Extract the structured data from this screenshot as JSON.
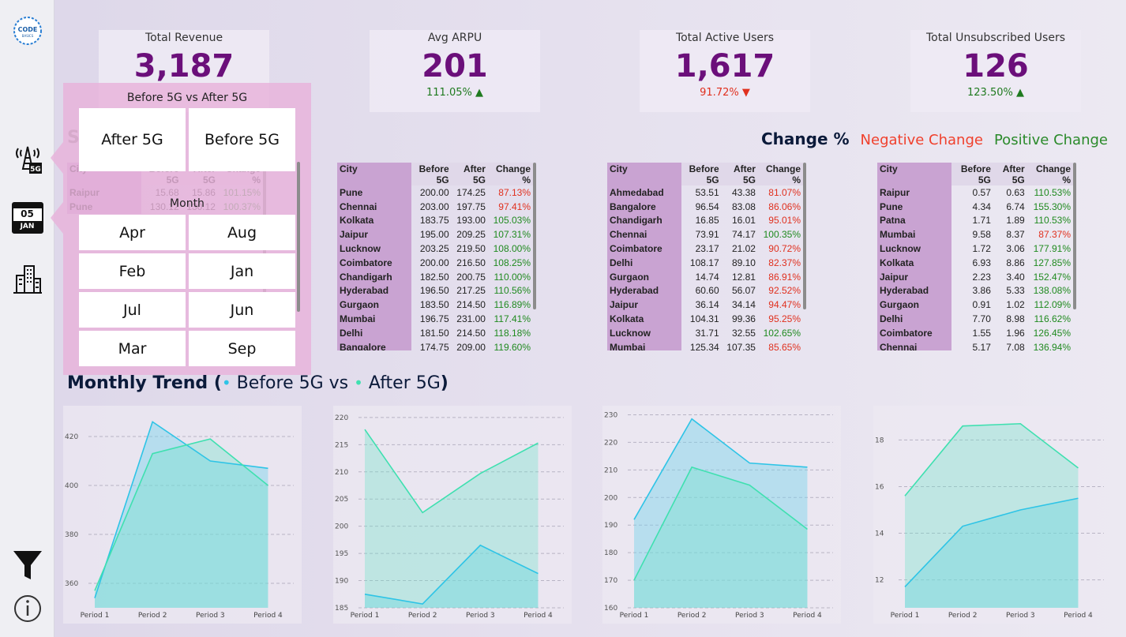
{
  "sidebar": {
    "logo_text": "CODE BASICS",
    "icons": [
      "tower-5g-icon",
      "calendar-icon",
      "city-icon",
      "filter-icon",
      "info-icon"
    ],
    "calendar_day": "05",
    "calendar_month": "JAN",
    "tower_label": "5G"
  },
  "kpis": [
    {
      "title": "Total Revenue",
      "value": "3,187",
      "change": "",
      "direction": "up"
    },
    {
      "title": "Avg ARPU",
      "value": "201",
      "change": "111.05%",
      "direction": "up"
    },
    {
      "title": "Total Active Users",
      "value": "1,617",
      "change": "91.72%",
      "direction": "down"
    },
    {
      "title": "Total Unsubscribed Users",
      "value": "126",
      "change": "123.50%",
      "direction": "up"
    }
  ],
  "legend": {
    "label": "Change %",
    "negative": "Negative Change",
    "positive": "Positive Change"
  },
  "section_letter": "S",
  "tables": [
    {
      "headers": [
        "City",
        "Before 5G",
        "After 5G",
        "Change %"
      ],
      "rows": [
        [
          "Raipur",
          "15.68",
          "15.86",
          "101.15%"
        ],
        [
          "Pune",
          "130.12",
          "130.12",
          "100.37%"
        ]
      ]
    },
    {
      "headers": [
        "City",
        "Before 5G",
        "After 5G",
        "Change %"
      ],
      "rows": [
        [
          "Pune",
          "200.00",
          "174.25",
          "87.13%"
        ],
        [
          "Chennai",
          "203.00",
          "197.75",
          "97.41%"
        ],
        [
          "Kolkata",
          "183.75",
          "193.00",
          "105.03%"
        ],
        [
          "Jaipur",
          "195.00",
          "209.25",
          "107.31%"
        ],
        [
          "Lucknow",
          "203.25",
          "219.50",
          "108.00%"
        ],
        [
          "Coimbatore",
          "200.00",
          "216.50",
          "108.25%"
        ],
        [
          "Chandigarh",
          "182.50",
          "200.75",
          "110.00%"
        ],
        [
          "Hyderabad",
          "196.50",
          "217.25",
          "110.56%"
        ],
        [
          "Gurgaon",
          "183.50",
          "214.50",
          "116.89%"
        ],
        [
          "Mumbai",
          "196.75",
          "231.00",
          "117.41%"
        ],
        [
          "Delhi",
          "181.50",
          "214.50",
          "118.18%"
        ],
        [
          "Bangalore",
          "174.75",
          "209.00",
          "119.60%"
        ]
      ]
    },
    {
      "headers": [
        "City",
        "Before 5G",
        "After 5G",
        "Change %"
      ],
      "rows": [
        [
          "Ahmedabad",
          "53.51",
          "43.38",
          "81.07%"
        ],
        [
          "Bangalore",
          "96.54",
          "83.08",
          "86.06%"
        ],
        [
          "Chandigarh",
          "16.85",
          "16.01",
          "95.01%"
        ],
        [
          "Chennai",
          "73.91",
          "74.17",
          "100.35%"
        ],
        [
          "Coimbatore",
          "23.17",
          "21.02",
          "90.72%"
        ],
        [
          "Delhi",
          "108.17",
          "89.10",
          "82.37%"
        ],
        [
          "Gurgaon",
          "14.74",
          "12.81",
          "86.91%"
        ],
        [
          "Hyderabad",
          "60.60",
          "56.07",
          "92.52%"
        ],
        [
          "Jaipur",
          "36.14",
          "34.14",
          "94.47%"
        ],
        [
          "Kolkata",
          "104.31",
          "99.36",
          "95.25%"
        ],
        [
          "Lucknow",
          "31.71",
          "32.55",
          "102.65%"
        ],
        [
          "Mumbai",
          "125.34",
          "107.35",
          "85.65%"
        ]
      ]
    },
    {
      "headers": [
        "City",
        "Before 5G",
        "After 5G",
        "Change %"
      ],
      "rows": [
        [
          "Raipur",
          "0.57",
          "0.63",
          "110.53%"
        ],
        [
          "Pune",
          "4.34",
          "6.74",
          "155.30%"
        ],
        [
          "Patna",
          "1.71",
          "1.89",
          "110.53%"
        ],
        [
          "Mumbai",
          "9.58",
          "8.37",
          "87.37%"
        ],
        [
          "Lucknow",
          "1.72",
          "3.06",
          "177.91%"
        ],
        [
          "Kolkata",
          "6.93",
          "8.86",
          "127.85%"
        ],
        [
          "Jaipur",
          "2.23",
          "3.40",
          "152.47%"
        ],
        [
          "Hyderabad",
          "3.86",
          "5.33",
          "138.08%"
        ],
        [
          "Gurgaon",
          "0.91",
          "1.02",
          "112.09%"
        ],
        [
          "Delhi",
          "7.70",
          "8.98",
          "116.62%"
        ],
        [
          "Coimbatore",
          "1.55",
          "1.96",
          "126.45%"
        ],
        [
          "Chennai",
          "5.17",
          "7.08",
          "136.94%"
        ]
      ]
    }
  ],
  "trend": {
    "title": "Monthly Trend (",
    "before": "Before 5G",
    "vs": "vs",
    "after": "After 5G",
    "close": ")"
  },
  "colors": {
    "before": "#2ec4e6",
    "after": "#3fe0b0",
    "accent": "#6b0f7a",
    "positive": "#1f8a1f",
    "negative": "#e0301e"
  },
  "chart_data": [
    {
      "type": "area",
      "x": [
        "Period 1",
        "Period 2",
        "Period 3",
        "Period 4"
      ],
      "ylim": [
        350,
        430
      ],
      "yticks": [
        360,
        380,
        400,
        420
      ],
      "series": [
        {
          "name": "Before 5G",
          "values": [
            354,
            426,
            410,
            407
          ]
        },
        {
          "name": "After 5G",
          "values": [
            357,
            413,
            419,
            400
          ]
        }
      ]
    },
    {
      "type": "area",
      "x": [
        "Period 1",
        "Period 2",
        "Period 3",
        "Period 4"
      ],
      "ylim": [
        185,
        221
      ],
      "yticks": [
        185,
        190,
        195,
        200,
        205,
        210,
        215,
        220
      ],
      "series": [
        {
          "name": "Before 5G",
          "values": [
            187.5,
            185.7,
            196.5,
            191.3
          ]
        },
        {
          "name": "After 5G",
          "values": [
            217.8,
            202.5,
            209.7,
            215.3
          ]
        }
      ]
    },
    {
      "type": "area",
      "x": [
        "Period 1",
        "Period 2",
        "Period 3",
        "Period 4"
      ],
      "ylim": [
        160,
        231
      ],
      "yticks": [
        160,
        170,
        180,
        190,
        200,
        210,
        220,
        230
      ],
      "series": [
        {
          "name": "Before 5G",
          "values": [
            192,
            228.5,
            212.5,
            211
          ]
        },
        {
          "name": "After 5G",
          "values": [
            170,
            211,
            204.5,
            188.5
          ]
        }
      ]
    },
    {
      "type": "area",
      "x": [
        "Period 1",
        "Period 2",
        "Period 3",
        "Period 4"
      ],
      "ylim": [
        10.8,
        19.2
      ],
      "yticks": [
        12,
        14,
        16,
        18
      ],
      "series": [
        {
          "name": "Before 5G",
          "values": [
            11.7,
            14.3,
            15.0,
            15.5
          ]
        },
        {
          "name": "After 5G",
          "values": [
            15.6,
            18.6,
            18.7,
            16.8
          ]
        }
      ]
    }
  ],
  "slicers": {
    "plan": {
      "title": "Before 5G vs After 5G",
      "options": [
        "After 5G",
        "Before 5G"
      ]
    },
    "month": {
      "title": "Month",
      "options": [
        "Apr",
        "Aug",
        "Feb",
        "Jan",
        "Jul",
        "Jun",
        "Mar",
        "Sep"
      ]
    }
  }
}
